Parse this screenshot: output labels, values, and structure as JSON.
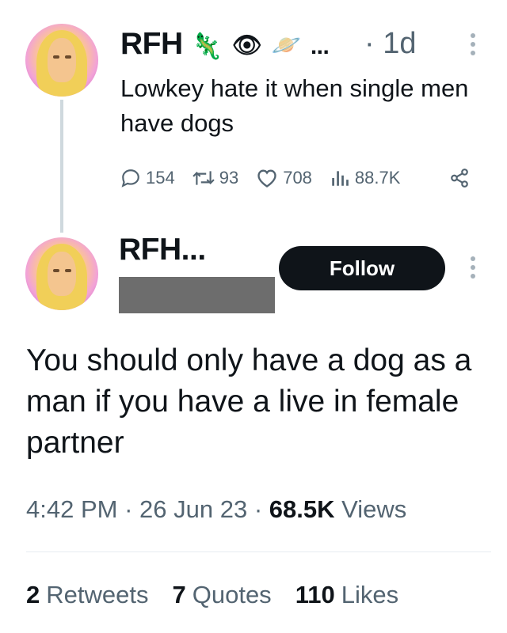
{
  "reply_to": {
    "name": "RFH",
    "emoji": [
      {
        "icon": "lizard-icon",
        "glyph": "🦎"
      },
      {
        "icon": "eye-speech-bubble-icon",
        "glyph": "👁"
      },
      {
        "icon": "ringed-planet-icon",
        "glyph": "🪐"
      }
    ],
    "ellipsis": "...",
    "dot": "·",
    "time_ago": "1d",
    "text": "Lowkey hate it when single men have dogs",
    "actions": {
      "replies": "154",
      "retweets": "93",
      "likes": "708",
      "views": "88.7K"
    }
  },
  "main": {
    "name": "RFH...",
    "follow_label": "Follow",
    "text": "You should only have a dog as a man if you have a live in female partner",
    "time": "4:42 PM",
    "sep1": "·",
    "date": "26 Jun 23",
    "sep2": "·",
    "views_count": "68.5K",
    "views_label": "Views",
    "stats": {
      "retweets_count": "2",
      "retweets_label": "Retweets",
      "quotes_count": "7",
      "quotes_label": "Quotes",
      "likes_count": "110",
      "likes_label": "Likes"
    }
  }
}
